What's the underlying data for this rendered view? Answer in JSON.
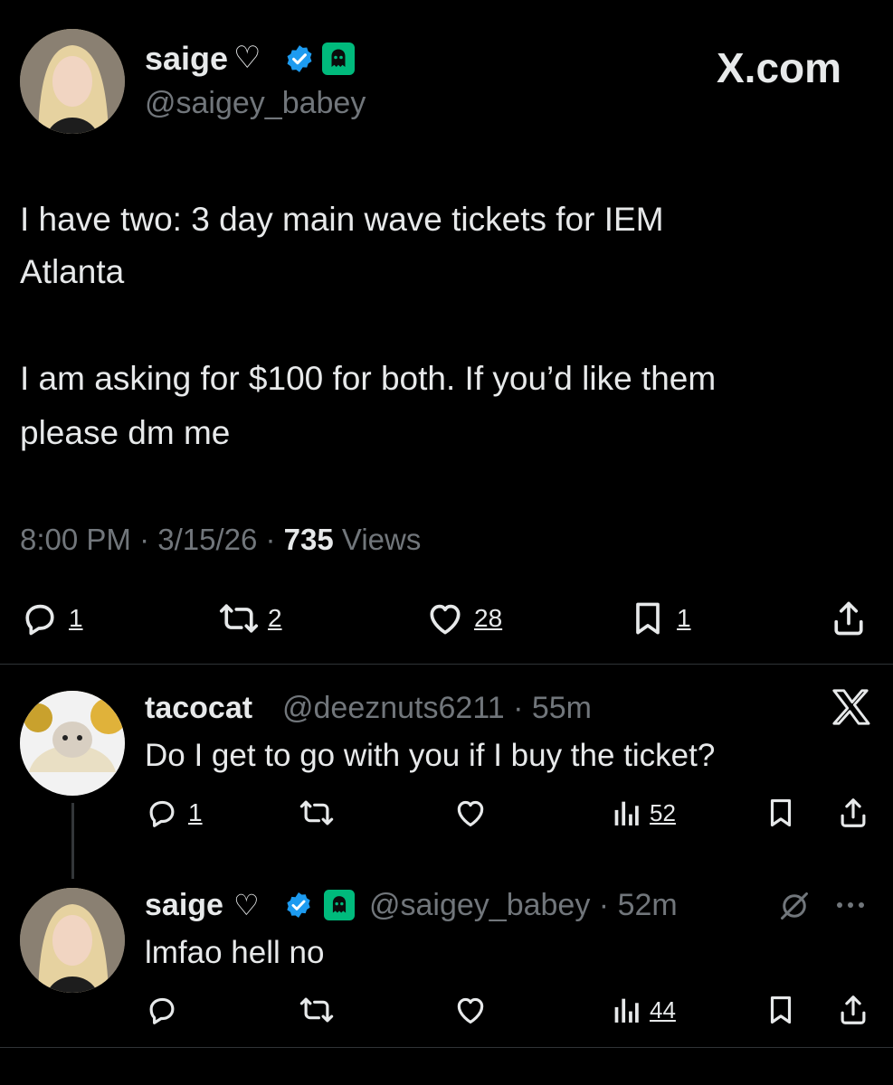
{
  "main_post": {
    "display_name": "saige",
    "name_heart": "♡",
    "handle": "@saigey_babey",
    "site": "X.com",
    "body_line1": "I have two: 3 day main wave tickets for IEM",
    "body_line2": "Atlanta",
    "body_line3": "I am asking for $100 for both. If you’d like them",
    "body_line4": "please dm me",
    "time": "8:00 PM",
    "date": "3/15/26",
    "views_count": "735",
    "views_label": "Views",
    "reply_count": "1",
    "repost_count": "2",
    "like_count": "28",
    "bookmark_count": "1"
  },
  "reply1": {
    "display_name": "tacocat",
    "handle": "@deeznuts6211",
    "time": "55m",
    "text": "Do I get to go with you if I buy the ticket?",
    "reply_count": "1",
    "views_count": "52"
  },
  "reply2": {
    "display_name": "saige",
    "name_heart": "♡",
    "handle": "@saigey_babey",
    "time": "52m",
    "text": "lmfao hell no",
    "views_count": "44"
  },
  "colors": {
    "background": "#000000",
    "text": "#e7e9ea",
    "muted": "#71767b",
    "verified": "#1d9bf0",
    "ghost_badge": "#00ba7c"
  },
  "icons": [
    "reply-icon",
    "repost-icon",
    "like-icon",
    "bookmark-icon",
    "share-icon",
    "views-icon",
    "verified-badge-icon",
    "ghost-badge-icon",
    "x-logo-icon",
    "grok-icon",
    "more-icon"
  ]
}
